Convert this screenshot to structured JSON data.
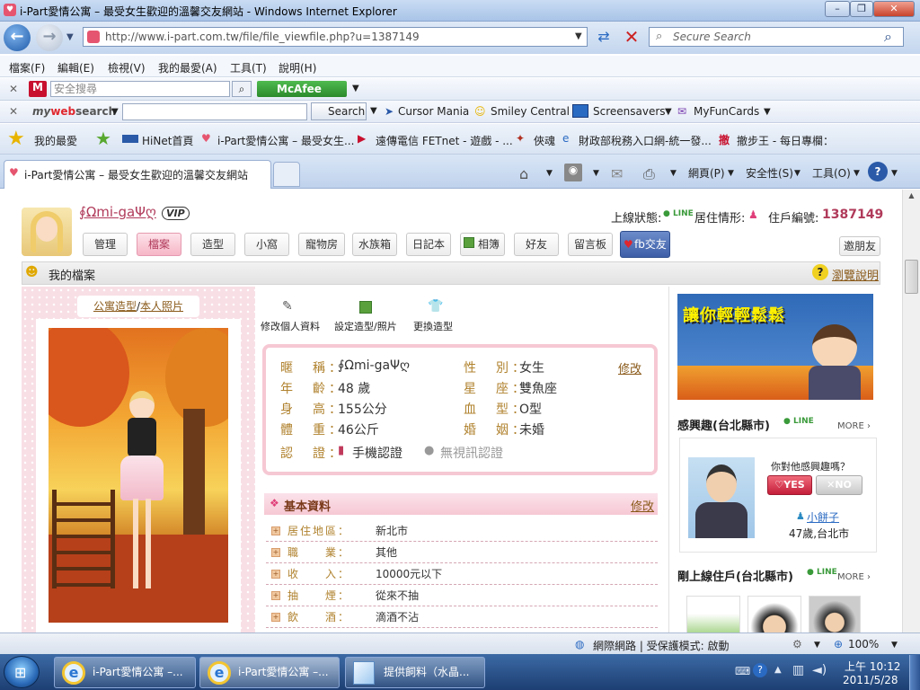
{
  "window": {
    "title": "i-Part愛情公寓 – 最受女生歡迎的溫馨交友網站 - Windows Internet Explorer"
  },
  "address": {
    "url": "http://www.i-part.com.tw/file/file_viewfile.php?u=1387149",
    "search_placeholder": "Secure Search"
  },
  "menu": [
    "檔案(F)",
    "編輯(E)",
    "檢視(V)",
    "我的最愛(A)",
    "工具(T)",
    "說明(H)"
  ],
  "mcafee": {
    "search_placeholder": "安全搜尋",
    "brand": "McAfee"
  },
  "mywebsearch": {
    "brand_my": "my",
    "brand_web": "web",
    "brand_search": "search",
    "search_button": "Search",
    "links": [
      "Cursor Mania",
      "Smiley Central",
      "Screensavers",
      "MyFunCards"
    ]
  },
  "favorites": {
    "label": "我的最愛",
    "items": [
      "HiNet首頁",
      "i-Part愛情公寓 – 最受女生...",
      "遠傳電信 FETnet - 遊戲 - ...",
      "俠魂",
      "財政部稅務入口網-統一發...",
      "撤步王 - 每日專欄："
    ]
  },
  "tab": {
    "title": "i-Part愛情公寓 – 最受女生歡迎的溫馨交友網站"
  },
  "commands": {
    "page": "網頁(P)",
    "safety": "安全性(S)",
    "tools": "工具(O)"
  },
  "profile": {
    "nickname": "∮Ωmi-gaΨღ",
    "vip": "VIP",
    "online_label": "上線狀態:",
    "live_label": "居住情形:",
    "id_label": "住戶編號:",
    "id": "1387149",
    "nav": [
      "管理",
      "檔案",
      "造型",
      "小窩",
      "寵物房",
      "水族箱",
      "日記本",
      "相簿",
      "好友",
      "留言板",
      "fb交友"
    ],
    "invite": "邀朋友",
    "section": "我的檔案",
    "help": "瀏覽說明",
    "photo_tabs": {
      "a": "公寓造型",
      "sep": "/",
      "b": "本人照片"
    },
    "actions": [
      "修改個人資料",
      "設定造型/照片",
      "更換造型"
    ],
    "info": {
      "left": [
        {
          "k": "暱　稱：",
          "v": "∮Ωmi-gaΨღ"
        },
        {
          "k": "年　齡：",
          "v": "48 歲"
        },
        {
          "k": "身　高：",
          "v": "155公分"
        },
        {
          "k": "體　重：",
          "v": "46公斤"
        }
      ],
      "right": [
        {
          "k": "性　別：",
          "v": "女生"
        },
        {
          "k": "星　座：",
          "v": "雙魚座"
        },
        {
          "k": "血　型：",
          "v": "O型"
        },
        {
          "k": "婚　姻：",
          "v": "未婚"
        }
      ],
      "cert_label": "認　證：",
      "cert_phone": "手機認證",
      "cert_video": "無視訊認證",
      "edit": "修改"
    },
    "basic": {
      "title": "基本資料",
      "edit": "修改",
      "rows": [
        {
          "k": "居住地區：",
          "v": "新北市"
        },
        {
          "k": "職　　業：",
          "v": "其他"
        },
        {
          "k": "收　　入：",
          "v": "10000元以下"
        },
        {
          "k": "抽　　煙：",
          "v": "從來不抽"
        },
        {
          "k": "飲　　酒：",
          "v": "滴酒不沾"
        }
      ]
    }
  },
  "sidebar": {
    "ad_text": "讓你輕輕鬆鬆",
    "interest_title": "感興趣(台北縣市)",
    "more": "MORE",
    "question": "你對他感興趣嗎？",
    "yes": "YES",
    "no": "NO",
    "person_name": "小餅子",
    "person_info": "47歲,台北市",
    "online_title": "剛上線住戶(台北縣市)"
  },
  "status": {
    "zone": "網際網路 | 受保護模式: 啟動",
    "zoom": "100%"
  },
  "taskbar": {
    "items": [
      "i-Part愛情公寓 –...",
      "i-Part愛情公寓 –...",
      "提供飼料（水晶..."
    ],
    "time": "上午 10:12",
    "date": "2011/5/28"
  }
}
